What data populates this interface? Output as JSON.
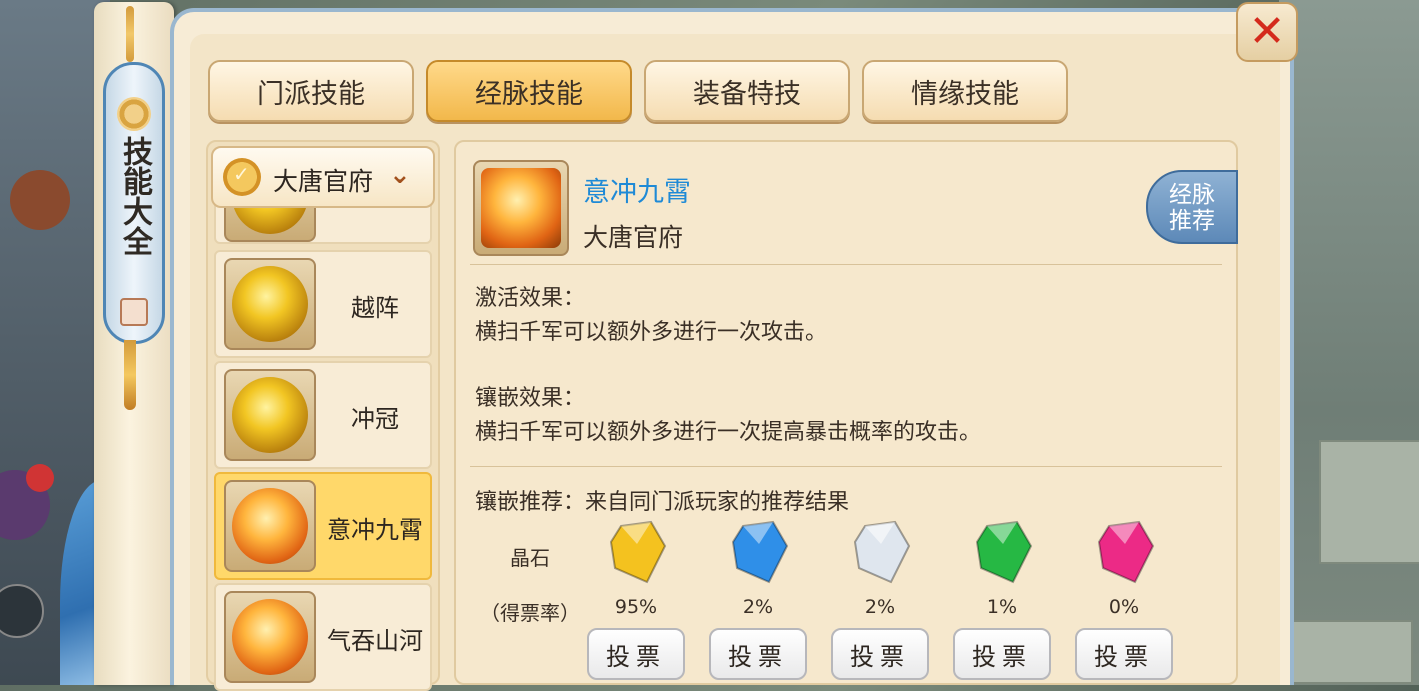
{
  "window": {
    "vertical_title": "技能大全",
    "close_icon": "close-icon"
  },
  "tabs": [
    {
      "label": "门派技能",
      "active": false
    },
    {
      "label": "经脉技能",
      "active": true
    },
    {
      "label": "装备特技",
      "active": false
    },
    {
      "label": "情缘技能",
      "active": false
    }
  ],
  "school_select": {
    "value": "大唐官府",
    "icon": "school-emblem-icon",
    "dropdown_icon": "chevron-down-icon"
  },
  "skill_list": [
    {
      "name": "越阵",
      "icon": "shield-crack-icon",
      "selected": false
    },
    {
      "name": "冲冠",
      "icon": "warrior-face-icon",
      "selected": false
    },
    {
      "name": "意冲九霄",
      "icon": "slash-flame-icon",
      "selected": true
    },
    {
      "name": "气吞山河",
      "icon": "pillar-flame-icon",
      "selected": false
    }
  ],
  "detail": {
    "name": "意冲九霄",
    "school": "大唐官府",
    "recommend_label": "经脉推荐",
    "activate_title": "激活效果：",
    "activate_text": "横扫千军可以额外多进行一次攻击。",
    "inlay_title": "镶嵌效果：",
    "inlay_text": "横扫千军可以额外多进行一次提高暴击概率的攻击。",
    "recommend_title": "镶嵌推荐：来自同门派玩家的推荐结果",
    "gem_label": "晶石",
    "rate_label": "（得票率）",
    "gems": [
      {
        "color": "#f4c21f",
        "icon": "yellow-crystal-icon",
        "rate": "95%",
        "vote": "投票"
      },
      {
        "color": "#2f8fe8",
        "icon": "blue-crystal-icon",
        "rate": "2%",
        "vote": "投票"
      },
      {
        "color": "#dfe6ee",
        "icon": "white-crystal-icon",
        "rate": "2%",
        "vote": "投票"
      },
      {
        "color": "#26b844",
        "icon": "green-crystal-icon",
        "rate": "1%",
        "vote": "投票"
      },
      {
        "color": "#ec2a86",
        "icon": "pink-crystal-icon",
        "rate": "0%",
        "vote": "投票"
      }
    ]
  }
}
